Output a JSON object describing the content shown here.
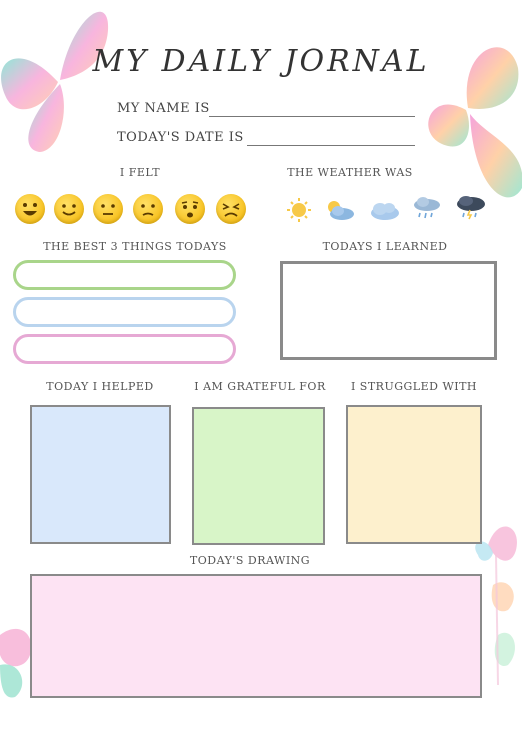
{
  "header": {
    "title": "MY DAILY JORNAL",
    "name_label": "MY NAME IS",
    "date_label": "TODAY'S DATE IS"
  },
  "sections": {
    "felt": "I FELT",
    "weather": "THE WEATHER WAS",
    "best_things": "THE BEST 3 THINGS TODAYS",
    "learned": "TODAYS I LEARNED",
    "helped": "TODAY I HELPED",
    "grateful": "I AM GRATEFUL FOR",
    "struggled": "I STRUGGLED WITH",
    "drawing": "TODAY'S DRAWING"
  },
  "moods": [
    "very-happy-face-icon",
    "happy-face-icon",
    "neutral-face-icon",
    "confused-face-icon",
    "worried-face-icon",
    "upset-face-icon"
  ],
  "weather_icons": [
    "sunny-icon",
    "partly-cloudy-icon",
    "cloudy-icon",
    "rain-icon",
    "storm-icon"
  ],
  "colors": {
    "pill_1": "#a9d58a",
    "pill_2": "#b9d4ee",
    "pill_3": "#e6a9d4",
    "helped_fill": "#d9e8fb",
    "grateful_fill": "#d8f5c8",
    "struggled_fill": "#fdf0cd",
    "drawing_fill": "#fde3f3"
  }
}
